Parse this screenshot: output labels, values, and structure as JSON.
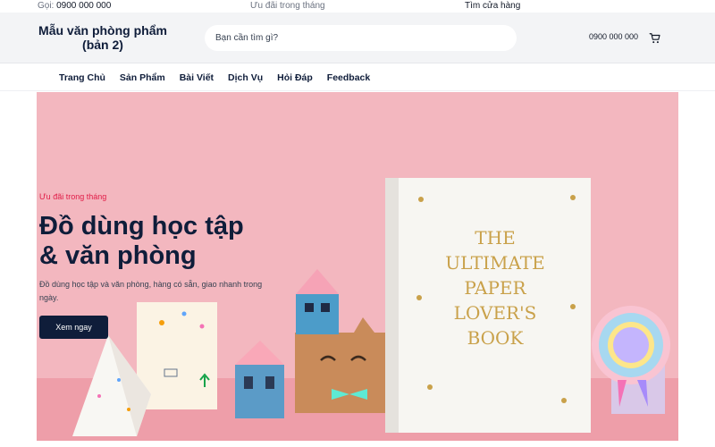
{
  "topbar": {
    "call_prefix": "Gọi:",
    "call_number": "0900 000 000",
    "promo": "Ưu đãi trong tháng",
    "stores": "Tìm cửa hàng"
  },
  "header": {
    "logo_line1": "Mẫu văn phòng phẩm",
    "logo_line2": "(bản 2)",
    "search_placeholder": "Bạn cần tìm gì?",
    "phone": "0900 000 000"
  },
  "nav": {
    "items": [
      "Trang Chủ",
      "Sản Phẩm",
      "Bài Viết",
      "Dịch Vụ",
      "Hỏi Đáp",
      "Feedback"
    ]
  },
  "hero": {
    "eyebrow": "Ưu đãi trong tháng",
    "title_line1": "Đồ dùng học tập",
    "title_line2": "& văn phòng",
    "description": "Đồ dùng học tập và văn phòng, hàng có sẵn, giao nhanh trong ngày.",
    "cta": "Xem ngay",
    "book_lines": [
      "THE",
      "ULTIMATE",
      "PAPER",
      "LOVER'S",
      "BOOK"
    ]
  },
  "colors": {
    "navy": "#0f1d3a",
    "hero_bg": "#f3b7bf",
    "accent_red": "#e11d48"
  }
}
